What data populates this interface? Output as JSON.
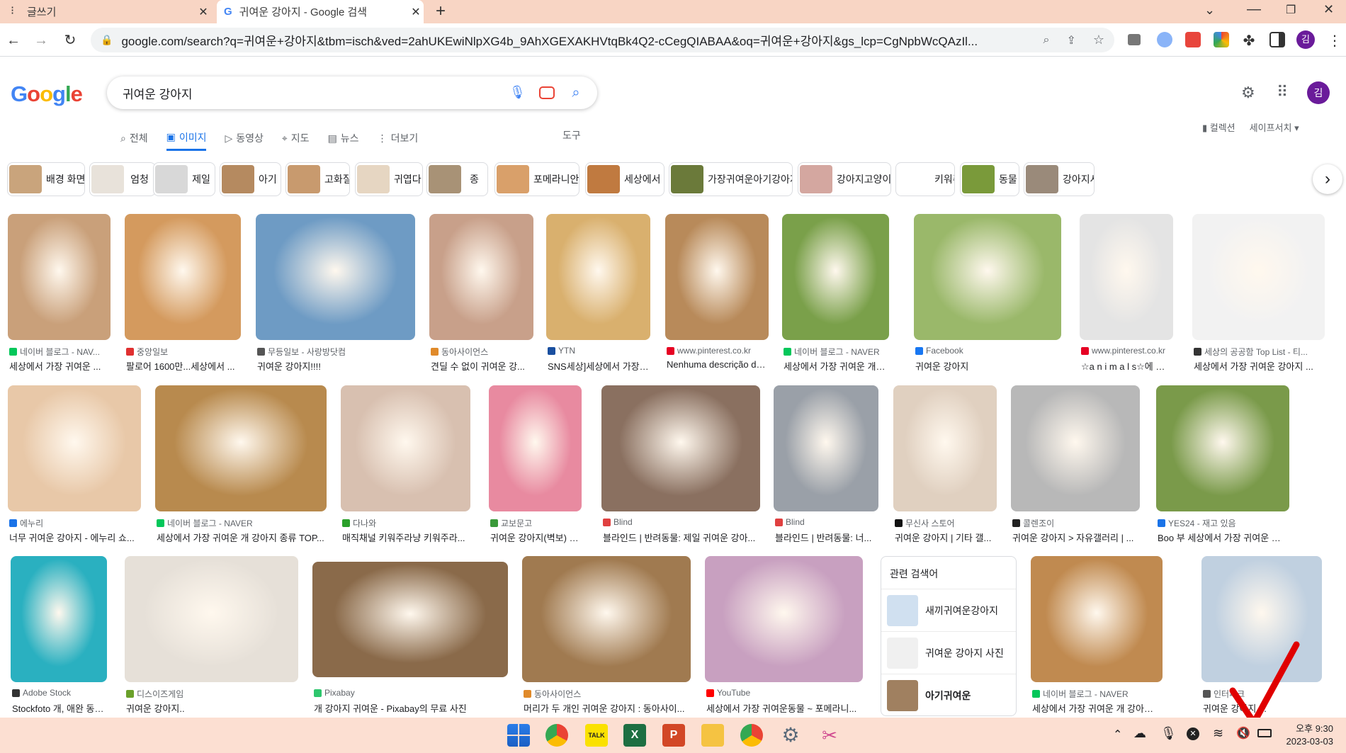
{
  "browser": {
    "tabs": [
      {
        "title": "글쓰기"
      },
      {
        "title": "귀여운 강아지 - Google 검색"
      }
    ],
    "url": "google.com/search?q=귀여운+강아지&tbm=isch&ved=2ahUKEwiNlpXG4b_9AhXGEXAKHVtqBk4Q2-cCegQIABAA&oq=귀여운+강아지&gs_lcp=CgNpbWcQAzIl...",
    "profile_initial": "김"
  },
  "google": {
    "logo": "Google",
    "query": "귀여운 강아지",
    "tabs": [
      "전체",
      "이미지",
      "동영상",
      "지도",
      "뉴스",
      "더보기"
    ],
    "tools": "도구",
    "collections": "컬렉션",
    "safesearch": "세이프서치 ▾",
    "avatar": "김"
  },
  "chips": [
    {
      "label": "배경 화면",
      "color": "#c9a47c"
    },
    {
      "label": "엄청",
      "color": "#e8e2da"
    },
    {
      "label": "제일",
      "color": "#d8d8d8"
    },
    {
      "label": "아기",
      "color": "#b58a60"
    },
    {
      "label": "고화질",
      "color": "#c89a6e"
    },
    {
      "label": "귀엽다",
      "color": "#e6d6c2"
    },
    {
      "label": "종",
      "color": "#a89276"
    },
    {
      "label": "포메라니안",
      "color": "#d9a06a"
    },
    {
      "label": "세상에서",
      "color": "#c07a40"
    },
    {
      "label": "가장귀여운아기강아지",
      "color": "#6b7a3a"
    },
    {
      "label": "강아지고양이",
      "color": "#d4a7a0"
    },
    {
      "label": "키워주라",
      "color": "#ffffff"
    },
    {
      "label": "동물",
      "color": "#7a9a3a"
    },
    {
      "label": "강아지사진",
      "color": "#9a8a7a"
    }
  ],
  "results": [
    {
      "source": "네이버 블로그 - NAV...",
      "title": "세상에서 가장 귀여운 ...",
      "color": "#c9a07a",
      "fav": "#03c75a"
    },
    {
      "source": "중앙일보",
      "title": "팔로어 1600만...세상에서 ...",
      "color": "#d49a5e",
      "fav": "#e03030"
    },
    {
      "source": "무등일보 - 사랑방닷컴",
      "title": "귀여운 강아지!!!!",
      "color": "#6e9bc4",
      "fav": "#555555"
    },
    {
      "source": "동아사이언스",
      "title": "견딜 수 없이 귀여운 강...",
      "color": "#c8a08a",
      "fav": "#e08a2a"
    },
    {
      "source": "YTN",
      "title": "SNS세상]세상에서 가장 ...",
      "color": "#d9b06e",
      "fav": "#1a4fa0"
    },
    {
      "source": "www.pinterest.co.kr",
      "title": "Nenhuma descrição de...",
      "color": "#b88a5a",
      "fav": "#e60023"
    },
    {
      "source": "네이버 블로그 - NAVER",
      "title": "세상에서 가장 귀여운 개 강...",
      "color": "#7aa04a",
      "fav": "#03c75a"
    },
    {
      "source": "Facebook",
      "title": "귀여운 강아지",
      "color": "#9ab86a",
      "fav": "#1877f2"
    },
    {
      "source": "www.pinterest.co.kr",
      "title": "☆a n i m a l s☆에 있는...",
      "color": "#e4e4e4",
      "fav": "#e60023"
    },
    {
      "source": "세상의 공공함 Top List - 티...",
      "title": "세상에서 가장 귀여운 강아지 ...",
      "color": "#f2f2f2",
      "fav": "#333333"
    },
    {
      "source": "에누리",
      "title": "너무 귀여운 강아지 - 에누리 쇼...",
      "color": "#e8c8a8",
      "fav": "#1a73e8"
    },
    {
      "source": "네이버 블로그 - NAVER",
      "title": "세상에서 가장 귀여운 개 강아지 종류 TOP...",
      "color": "#b88a4e",
      "fav": "#03c75a"
    },
    {
      "source": "다나와",
      "title": "매직채널 키워주라냥 키워주라...",
      "color": "#d8c0b0",
      "fav": "#2aa02a"
    },
    {
      "source": "교보문고",
      "title": "귀여운 강아지(벽보) | ...",
      "color": "#e88aa0",
      "fav": "#3a9a3a"
    },
    {
      "source": "Blind",
      "title": "블라인드 | 반려동물: 제일 귀여운 강아...",
      "color": "#8a7060",
      "fav": "#e04040"
    },
    {
      "source": "Blind",
      "title": "블라인드 | 반려동물: 너...",
      "color": "#9aa0a8",
      "fav": "#e04040"
    },
    {
      "source": "무신사 스토어",
      "title": "귀여운 강아지 | 기타 갤...",
      "color": "#e0d0c0",
      "fav": "#111111"
    },
    {
      "source": "콜렌조이",
      "title": "귀여운 강아지 > 자유갤러리 | ...",
      "color": "#b8b8b8",
      "fav": "#222222"
    },
    {
      "source": "YES24 - 재고 있음",
      "title": "Boo 부 세상에서 가장 귀여운 강아지의 ...",
      "color": "#7a9a4a",
      "fav": "#1a73e8"
    },
    {
      "source": "Adobe Stock",
      "title": "Stockfoto 개, 애완 동물...",
      "color": "#2ab0c0",
      "fav": "#333333"
    },
    {
      "source": "디스이즈게임",
      "title": "귀여운 강아지..",
      "color": "#e6e0d8",
      "fav": "#6aa02a"
    },
    {
      "source": "Pixabay",
      "title": "개 강아지 귀여운 - Pixabay의 무료 사진",
      "color": "#8a6a4a",
      "fav": "#2ec66d"
    },
    {
      "source": "동아사이언스",
      "title": "머리가 두 개인 귀여운 강아지 : 동아사이...",
      "color": "#a07a50",
      "fav": "#e08a2a"
    },
    {
      "source": "YouTube",
      "title": "세상에서 가장 귀여운동물 ~ 포메라니...",
      "color": "#c8a0c0",
      "fav": "#ff0000"
    },
    {
      "source": "네이버 블로그 - NAVER",
      "title": "세상에서 가장 귀여운 개 강아지 종류 ...",
      "color": "#c08a50",
      "fav": "#03c75a"
    },
    {
      "source": "인터파크",
      "title": "귀여운 강아지 ...",
      "color": "#c0d0e0",
      "fav": "#555555"
    }
  ],
  "related": {
    "heading": "관련 검색어",
    "items": [
      {
        "text": "새끼귀여운강아지",
        "color": "#d0e0f0"
      },
      {
        "text": "귀여운 강아지 사진",
        "color": "#f0f0f0"
      },
      {
        "text": "아기귀여운",
        "color": "#a08060"
      }
    ]
  },
  "taskbar": {
    "time": "오후 9:30",
    "date": "2023-03-03"
  }
}
